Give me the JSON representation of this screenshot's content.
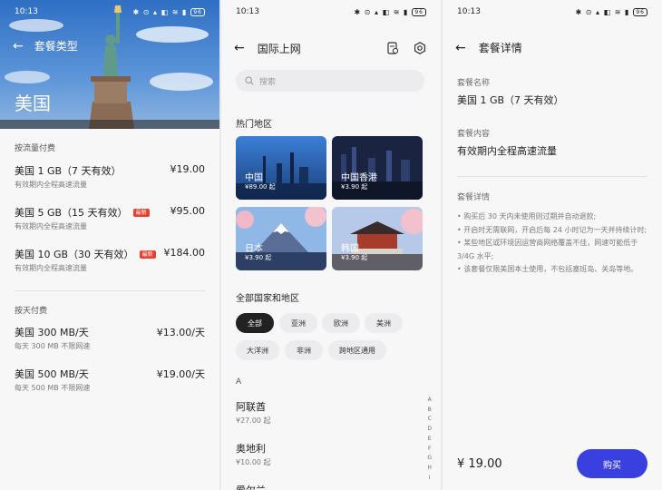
{
  "status": {
    "time": "10:13",
    "icons": "✱ ⊙ ▴ ◧ ≋ ▮",
    "battery": "96"
  },
  "panel1": {
    "nav_title": "套餐类型",
    "hero_title": "美国",
    "section_flow": "按流量付费",
    "flow_packages": [
      {
        "name": "美国 1 GB（7 天有效）",
        "price": "¥19.00",
        "sub": "有效期内全程高速流量",
        "tag": ""
      },
      {
        "name": "美国 5 GB（15 天有效）",
        "price": "¥95.00",
        "sub": "有效期内全程高速流量",
        "tag": "最新"
      },
      {
        "name": "美国 10 GB（30 天有效）",
        "price": "¥184.00",
        "sub": "有效期内全程高速流量",
        "tag": "最新"
      }
    ],
    "section_day": "按天付费",
    "day_packages": [
      {
        "name": "美国 300 MB/天",
        "price": "¥13.00/天",
        "sub": "每天 300 MB 不限网速"
      },
      {
        "name": "美国 500 MB/天",
        "price": "¥19.00/天",
        "sub": "每天 500 MB 不限网速"
      }
    ]
  },
  "panel2": {
    "nav_title": "国际上网",
    "search_placeholder": "搜索",
    "hot_title": "热门地区",
    "regions": [
      {
        "name": "中国",
        "price": "¥89.00 起"
      },
      {
        "name": "中国香港",
        "price": "¥3.90 起"
      },
      {
        "name": "日本",
        "price": "¥3.90 起"
      },
      {
        "name": "韩国",
        "price": "¥3.90 起"
      }
    ],
    "all_title": "全部国家和地区",
    "chips": [
      "全部",
      "亚洲",
      "欧洲",
      "美洲",
      "大洋洲",
      "非洲",
      "跨地区通用"
    ],
    "letter": "A",
    "countries": [
      {
        "name": "阿联酋",
        "price": "¥27.00 起"
      },
      {
        "name": "奥地利",
        "price": "¥10.00 起"
      },
      {
        "name": "爱尔兰",
        "price": ""
      }
    ],
    "alphabet": [
      "A",
      "B",
      "C",
      "D",
      "E",
      "F",
      "G",
      "H",
      "I"
    ]
  },
  "panel3": {
    "nav_title": "套餐详情",
    "name_label": "套餐名称",
    "name_value": "美国 1 GB（7 天有效）",
    "content_label": "套餐内容",
    "content_value": "有效期内全程高速流量",
    "detail_label": "套餐详情",
    "details": [
      "• 购买后 30 天内未使用则过期并自动退款;",
      "• 开启时无需联网，开启后每 24 小时记为一天并持续计时;",
      "• 某些地区或环境因运营商网络覆盖不佳，网速可能低于 3/4G 水平;",
      "• 该套餐仅限美国本土使用，不包括塞班岛、关岛等地。"
    ],
    "total": "¥ 19.00",
    "buy_label": "购买"
  },
  "colors": {
    "accent": "#3a3fe0",
    "tag": "#e8412f"
  }
}
